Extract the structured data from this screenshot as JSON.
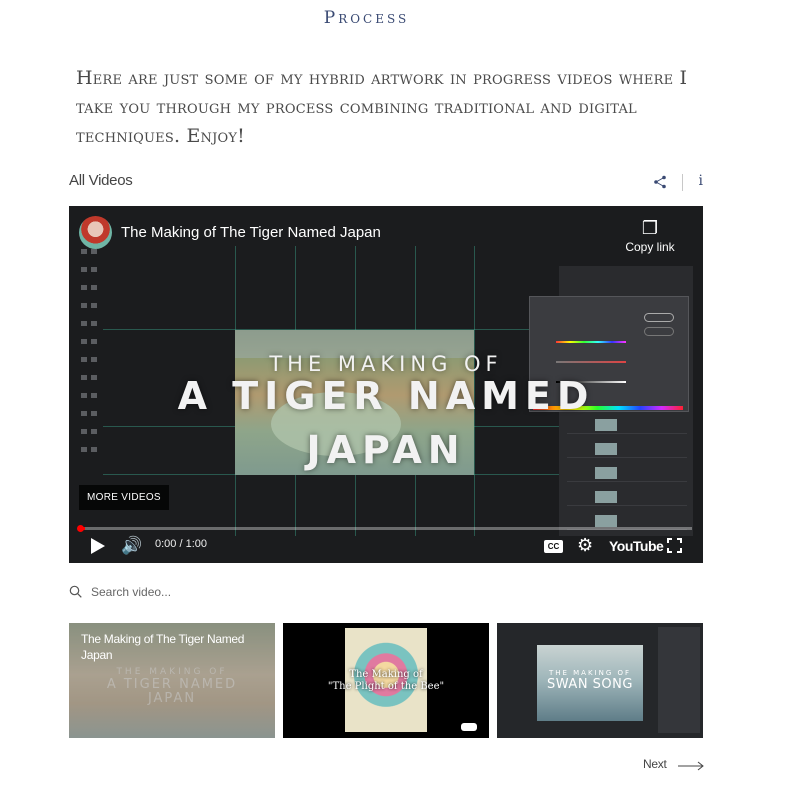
{
  "page": {
    "heading": "Process",
    "intro": "Here are just some of my hybrid artwork in progress videos where I take you through my process combining traditional and digital techniques. Enjoy!"
  },
  "gallery": {
    "title": "All Videos",
    "share_icon": "share-icon",
    "info_label": "i"
  },
  "player": {
    "video_title": "The Making of The Tiger Named Japan",
    "copy_link": "Copy link",
    "art_line1": "THE MAKING OF",
    "art_line2": "A TIGER NAMED",
    "art_line3": "JAPAN",
    "more_videos": "MORE VIDEOS",
    "time": "0:00 / 1:00",
    "progress_fraction": 0.01,
    "cc_label": "CC",
    "youtube_label": "YouTube",
    "accent": "#ff0000"
  },
  "search": {
    "placeholder": "Search video..."
  },
  "thumbnails": [
    {
      "title": "The Making of The Tiger Named Japan",
      "overlay_line1": "THE MAKING OF",
      "overlay_line2": "A TIGER NAMED",
      "overlay_line3": "JAPAN"
    },
    {
      "overlay_line1": "The Making of",
      "overlay_line2": "\"The Plight of the Bee\""
    },
    {
      "overlay_line1": "THE MAKING OF",
      "overlay_line2": "SWAN SONG"
    }
  ],
  "pagination": {
    "next_label": "Next"
  }
}
